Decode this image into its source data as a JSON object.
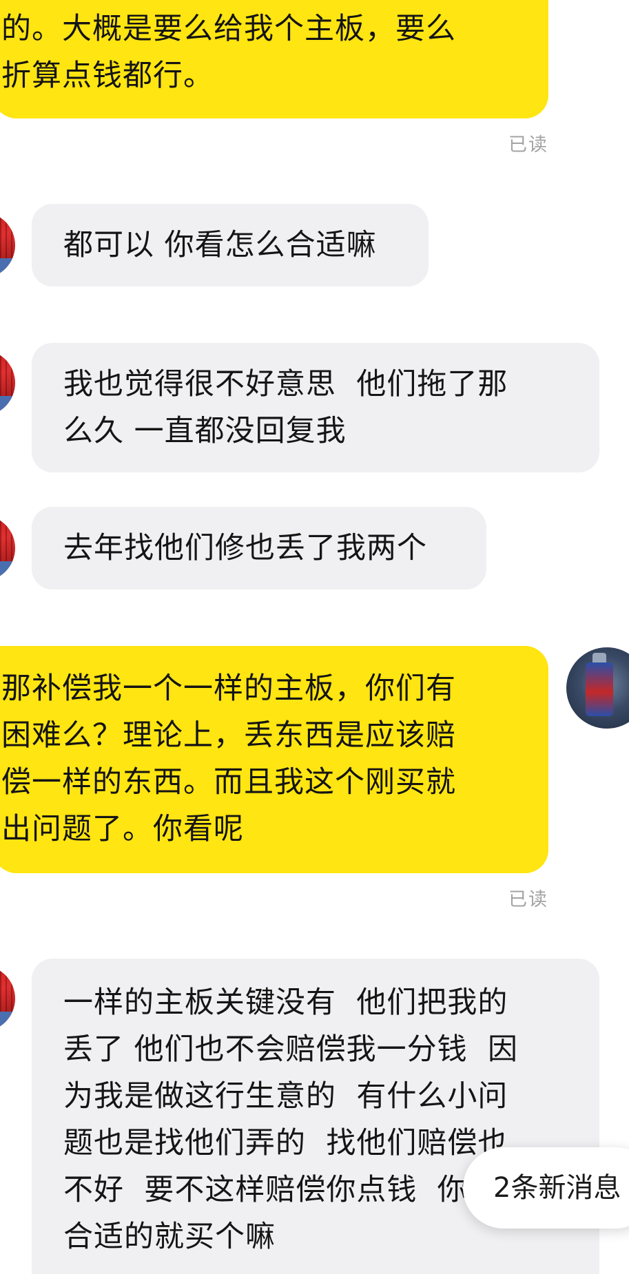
{
  "messages": [
    {
      "side": "mine",
      "text": "的。大概是要么给我个主板，要么\n折算点钱都行。",
      "status": "已读"
    },
    {
      "side": "theirs",
      "text": "都可以 你看怎么合适嘛"
    },
    {
      "side": "theirs",
      "text": "我也觉得很不好意思  他们拖了那\n么久 一直都没回复我"
    },
    {
      "side": "theirs",
      "text": "去年找他们修也丢了我两个"
    },
    {
      "side": "mine",
      "text": "那补偿我一个一样的主板，你们有\n困难么？理论上，丢东西是应该赔\n偿一样的东西。而且我这个刚买就\n出问题了。你看呢",
      "status": "已读"
    },
    {
      "side": "theirs",
      "text": "一样的主板关键没有  他们把我的\n丢了 他们也不会赔偿我一分钱  因\n为我是做这行生意的  有什么小问\n题也是找他们弄的  找他们赔偿也\n不好  要不这样赔偿你点钱  你\n合适的就买个嘛"
    }
  ],
  "new_message_indicator": "2条新消息",
  "colors": {
    "mine_bubble": "#ffe511",
    "theirs_bubble": "#f0f0f2",
    "read_receipt": "#a3a3a3",
    "background": "#ffffff"
  },
  "icons": {
    "contact_avatar": "contact-avatar-icon",
    "self_avatar": "self-avatar-icon"
  }
}
